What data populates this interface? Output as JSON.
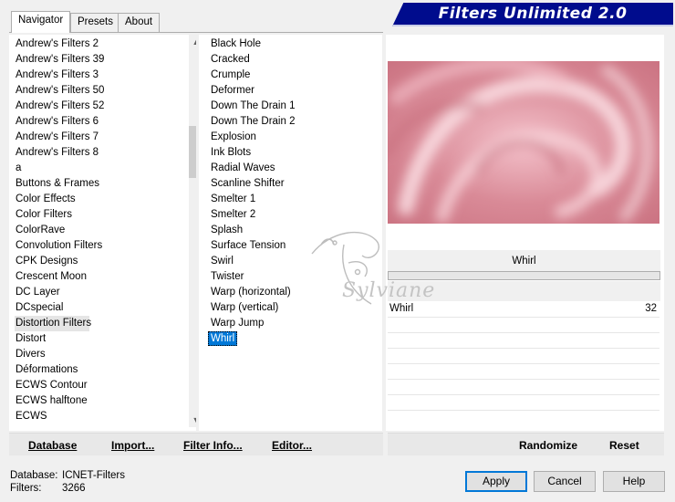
{
  "tabs": [
    {
      "label": "Navigator"
    },
    {
      "label": "Presets"
    },
    {
      "label": "About"
    }
  ],
  "header": {
    "title": "Filters Unlimited 2.0"
  },
  "categories": {
    "items": [
      "Andrew's Filters 2",
      "Andrew's Filters 39",
      "Andrew's Filters 3",
      "Andrew's Filters 50",
      "Andrew's Filters 52",
      "Andrew's Filters 6",
      "Andrew's Filters 7",
      "Andrew's Filters 8",
      "a",
      "Buttons & Frames",
      "Color Effects",
      "Color Filters",
      "ColorRave",
      "Convolution Filters",
      "CPK Designs",
      "Crescent Moon",
      "DC Layer",
      "DCspecial",
      "Distortion Filters",
      "Distort",
      "Divers",
      "Déformations",
      "ECWS Contour",
      "ECWS halftone",
      "ECWS"
    ],
    "selected": "Distortion Filters"
  },
  "filters": {
    "items": [
      "Black Hole",
      "Cracked",
      "Crumple",
      "Deformer",
      "Down The Drain 1",
      "Down The Drain 2",
      "Explosion",
      "Ink Blots",
      "Radial Waves",
      "Scanline Shifter",
      "Smelter 1",
      "Smelter 2",
      "Splash",
      "Surface Tension",
      "Swirl",
      "Twister",
      "Warp (horizontal)",
      "Warp (vertical)",
      "Warp Jump",
      "Whirl"
    ],
    "selected": "Whirl"
  },
  "preview": {
    "filter_name": "Whirl"
  },
  "params": [
    {
      "label": "Whirl",
      "value": "32"
    }
  ],
  "watermark": {
    "text": "Sylviane"
  },
  "toolbar": {
    "database": "Database",
    "import": "Import...",
    "filter_info": "Filter Info...",
    "editor": "Editor...",
    "randomize": "Randomize",
    "reset": "Reset"
  },
  "status": {
    "database_label": "Database:",
    "database_value": "ICNET-Filters",
    "filters_label": "Filters:",
    "filters_value": "3266"
  },
  "buttons": {
    "apply": "Apply",
    "cancel": "Cancel",
    "help": "Help"
  },
  "colors": {
    "banner": "#000c8d",
    "selection": "#0078d7",
    "preview_pink": "#d98a97"
  }
}
